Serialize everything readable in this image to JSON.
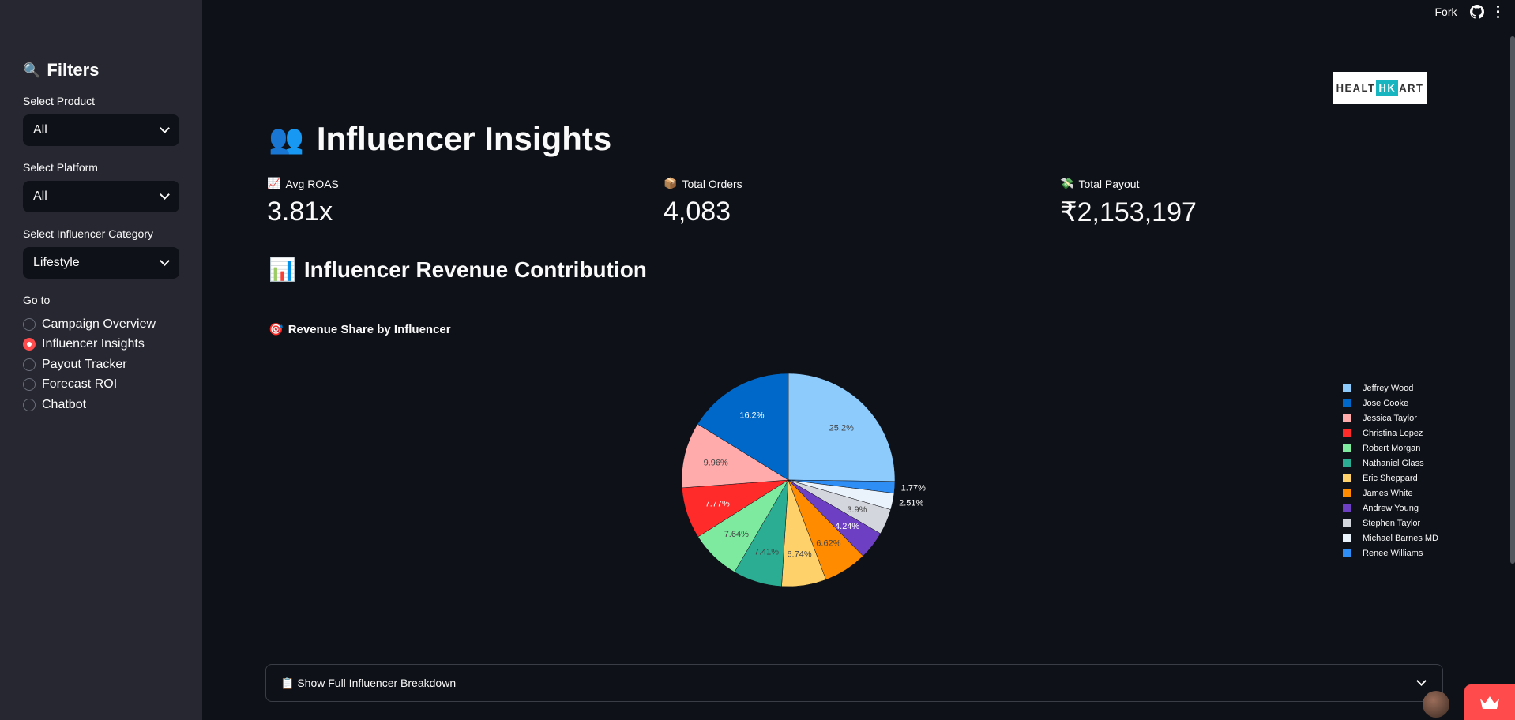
{
  "topbar": {
    "fork_label": "Fork",
    "github_icon": "github-icon",
    "menu_icon": "kebab-menu-icon"
  },
  "sidebar": {
    "title_icon": "🔍",
    "title": "Filters",
    "product": {
      "label": "Select Product",
      "value": "All"
    },
    "platform": {
      "label": "Select Platform",
      "value": "All"
    },
    "category": {
      "label": "Select Influencer Category",
      "value": "Lifestyle"
    },
    "nav_label": "Go to",
    "nav": [
      {
        "label": "Campaign Overview",
        "selected": false
      },
      {
        "label": "Influencer Insights",
        "selected": true
      },
      {
        "label": "Payout Tracker",
        "selected": false
      },
      {
        "label": "Forecast ROI",
        "selected": false
      },
      {
        "label": "Chatbot",
        "selected": false
      }
    ]
  },
  "logo": {
    "left": "HEALT",
    "mid": "HK",
    "right": "ART"
  },
  "page": {
    "title_icon": "👥",
    "title": "Influencer Insights",
    "metrics": [
      {
        "icon": "📈",
        "label": "Avg ROAS",
        "value": "3.81x"
      },
      {
        "icon": "📦",
        "label": "Total Orders",
        "value": "4,083"
      },
      {
        "icon": "💸",
        "label": "Total Payout",
        "value": "₹2,153,197"
      }
    ],
    "section_icon": "📊",
    "section_title": "Influencer Revenue Contribution",
    "chart_icon": "🎯",
    "chart_title": "Revenue Share by Influencer",
    "expander_icon": "📋",
    "expander_label": "Show Full Influencer Breakdown"
  },
  "chart_data": {
    "type": "pie",
    "title": "Revenue Share by Influencer",
    "slices": [
      {
        "name": "Jeffrey Wood",
        "pct": 25.2,
        "label": "25.2%",
        "color": "#8ecbfd"
      },
      {
        "name": "Renee Williams",
        "pct": 1.77,
        "label": "1.77%",
        "color": "#2f8ef5"
      },
      {
        "name": "Michael Barnes MD",
        "pct": 2.51,
        "label": "2.51%",
        "color": "#eaf2fb"
      },
      {
        "name": "Stephen Taylor",
        "pct": 3.9,
        "label": "3.9%",
        "color": "#d4d6dd"
      },
      {
        "name": "Andrew Young",
        "pct": 4.24,
        "label": "4.24%",
        "color": "#6c3fc3"
      },
      {
        "name": "James White",
        "pct": 6.62,
        "label": "6.62%",
        "color": "#ff8c00"
      },
      {
        "name": "Eric Sheppard",
        "pct": 6.74,
        "label": "6.74%",
        "color": "#ffd16a"
      },
      {
        "name": "Nathaniel Glass",
        "pct": 7.41,
        "label": "7.41%",
        "color": "#2aad92"
      },
      {
        "name": "Robert Morgan",
        "pct": 7.64,
        "label": "7.64%",
        "color": "#7deaa0"
      },
      {
        "name": "Christina Lopez",
        "pct": 7.77,
        "label": "7.77%",
        "color": "#ff2b2b"
      },
      {
        "name": "Jessica Taylor",
        "pct": 9.96,
        "label": "9.96%",
        "color": "#ffabab"
      },
      {
        "name": "Jose Cooke",
        "pct": 16.2,
        "label": "16.2%",
        "color": "#0068c9"
      }
    ],
    "legend_order": [
      "Jeffrey Wood",
      "Jose Cooke",
      "Jessica Taylor",
      "Christina Lopez",
      "Robert Morgan",
      "Nathaniel Glass",
      "Eric Sheppard",
      "James White",
      "Andrew Young",
      "Stephen Taylor",
      "Michael Barnes MD",
      "Renee Williams"
    ],
    "legend_position": "right"
  }
}
